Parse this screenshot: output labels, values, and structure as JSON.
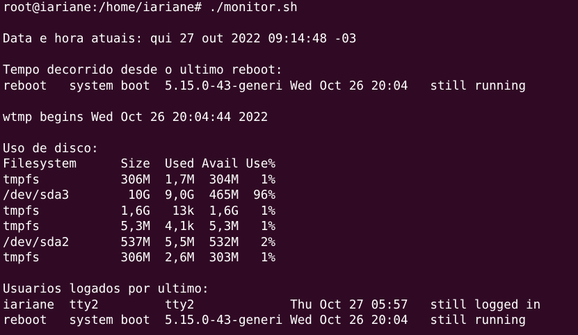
{
  "prompt": "root@iariane:/home/iariane# ",
  "command": "./monitor.sh",
  "datetime_line": "Data e hora atuais: qui 27 out 2022 09:14:48 -03",
  "uptime_header": "Tempo decorrido desde o ultimo reboot:",
  "uptime_line": "reboot   system boot  5.15.0-43-generi Wed Oct 26 20:04   still running",
  "wtmp_line": "wtmp begins Wed Oct 26 20:04:44 2022",
  "disk_header": "Uso de disco:",
  "disk_table": {
    "header": "Filesystem      Size  Used Avail Use%",
    "rows": [
      "tmpfs           306M  1,7M  304M   1%",
      "/dev/sda3        10G  9,0G  465M  96%",
      "tmpfs           1,6G   13k  1,6G   1%",
      "tmpfs           5,3M  4,1k  5,3M   1%",
      "/dev/sda2       537M  5,5M  532M   2%",
      "tmpfs           306M  2,6M  303M   1%"
    ]
  },
  "last_header": "Usuarios logados por ultimo:",
  "last_lines": [
    "iariane  tty2         tty2             Thu Oct 27 05:57   still logged in",
    "reboot   system boot  5.15.0-43-generi Wed Oct 26 20:04   still running"
  ]
}
